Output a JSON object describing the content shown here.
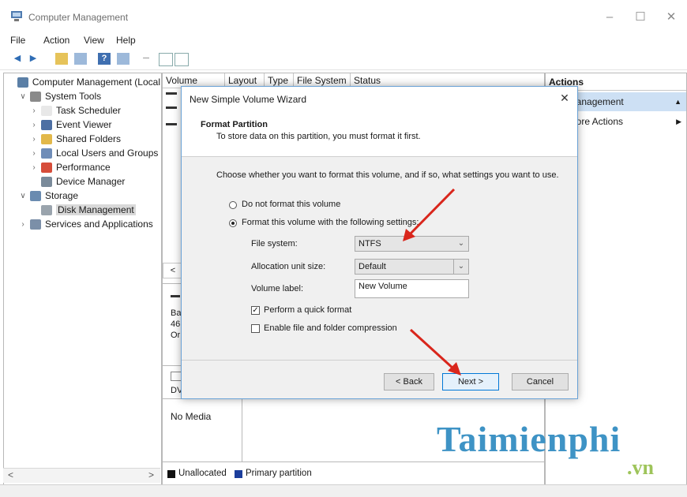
{
  "window": {
    "title": "Computer Management"
  },
  "menu": [
    "File",
    "Action",
    "View",
    "Help"
  ],
  "tree": {
    "items": [
      {
        "label": "Computer Management (Local",
        "level": 0,
        "twisty": "",
        "icon": "computer-icon",
        "color": "#5b7fa6"
      },
      {
        "label": "System Tools",
        "level": 1,
        "twisty": "v",
        "icon": "tools-icon",
        "color": "#8a8a8a"
      },
      {
        "label": "Task Scheduler",
        "level": 2,
        "twisty": ">",
        "icon": "clock-icon",
        "color": "#e8e8e8"
      },
      {
        "label": "Event Viewer",
        "level": 2,
        "twisty": ">",
        "icon": "event-viewer-icon",
        "color": "#4d6fa3"
      },
      {
        "label": "Shared Folders",
        "level": 2,
        "twisty": ">",
        "icon": "shared-folder-icon",
        "color": "#e2b84a"
      },
      {
        "label": "Local Users and Groups",
        "level": 2,
        "twisty": ">",
        "icon": "users-icon",
        "color": "#6f8db8"
      },
      {
        "label": "Performance",
        "level": 2,
        "twisty": ">",
        "icon": "performance-icon",
        "color": "#d64d3a"
      },
      {
        "label": "Device Manager",
        "level": 2,
        "twisty": "",
        "icon": "device-manager-icon",
        "color": "#7a8a9a"
      },
      {
        "label": "Storage",
        "level": 1,
        "twisty": "v",
        "icon": "storage-icon",
        "color": "#6a8bb0"
      },
      {
        "label": "Disk Management",
        "level": 2,
        "twisty": "",
        "icon": "disk-icon",
        "color": "#9aa4ad",
        "selected": true
      },
      {
        "label": "Services and Applications",
        "level": 1,
        "twisty": ">",
        "icon": "services-icon",
        "color": "#7b8fa8"
      }
    ]
  },
  "volume_table": {
    "columns": [
      "Volume",
      "Layout",
      "Type",
      "File System",
      "Status"
    ]
  },
  "disk_panel": {
    "disk0_partial": [
      "Ba",
      "46",
      "Or"
    ],
    "dvd_partial": "DV",
    "no_media": "No Media"
  },
  "legend": {
    "unallocated": "Unallocated",
    "primary": "Primary partition",
    "unallocated_color": "#111111",
    "primary_color": "#1c3e9c"
  },
  "actions": {
    "header": "Actions",
    "selected_item": "lanagement",
    "more_actions": "lore Actions"
  },
  "dialog": {
    "title": "New Simple Volume Wizard",
    "header_title": "Format Partition",
    "header_subtitle": "To store data on this partition, you must format it first.",
    "prompt": "Choose whether you want to format this volume, and if so, what settings you want to use.",
    "option_no_format": "Do not format this volume",
    "option_format": "Format this volume with the following settings:",
    "file_system_label": "File system:",
    "file_system_value": "NTFS",
    "alloc_label": "Allocation unit size:",
    "alloc_value": "Default",
    "volume_label_label": "Volume label:",
    "volume_label_value": "New Volume",
    "quick_format_label": "Perform a quick format",
    "quick_format_checked": true,
    "compression_label": "Enable file and folder compression",
    "compression_checked": false,
    "back_button": "< Back",
    "next_button": "Next >",
    "cancel_button": "Cancel"
  },
  "watermark": {
    "brand": "Taimienphi",
    "tld": ".vn"
  },
  "colors": {
    "accent": "#3e93c5",
    "annotation_arrow": "#d9261c",
    "dialog_border": "#6aa2d6",
    "selected_action": "#cde0f4"
  }
}
